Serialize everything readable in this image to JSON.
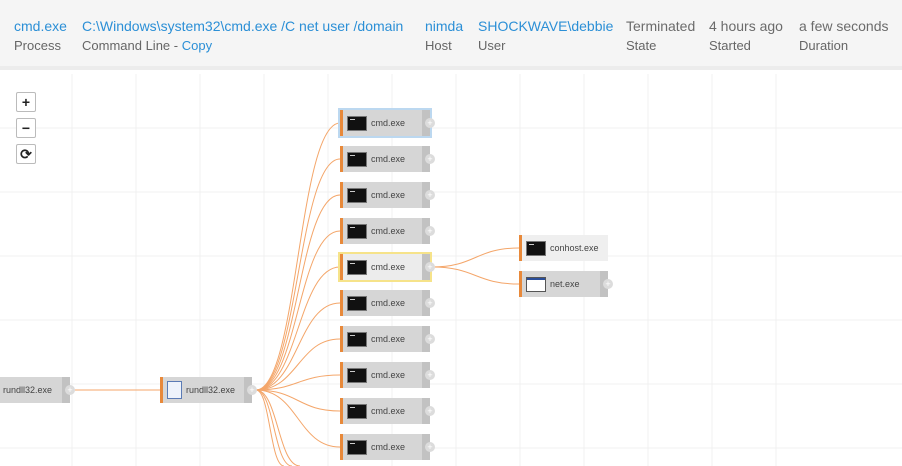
{
  "header": {
    "process": {
      "value": "cmd.exe",
      "label": "Process"
    },
    "command": {
      "value": "C:\\Windows\\system32\\cmd.exe /C net user /domain",
      "label": "Command Line - ",
      "copy": "Copy"
    },
    "host": {
      "value": "nimda",
      "label": "Host"
    },
    "user": {
      "value": "SHOCKWAVE\\debbie",
      "label": "User"
    },
    "state": {
      "value": "Terminated",
      "label": "State"
    },
    "started": {
      "value": "4 hours ago",
      "label": "Started"
    },
    "duration": {
      "value": "a few seconds",
      "label": "Duration"
    }
  },
  "controls": {
    "zoom_in": "+",
    "zoom_out": "−",
    "reset": "⟳"
  },
  "nodes": {
    "root": "rundll32.exe",
    "parent": "rundll32.exe",
    "cmd": [
      "cmd.exe",
      "cmd.exe",
      "cmd.exe",
      "cmd.exe",
      "cmd.exe",
      "cmd.exe",
      "cmd.exe",
      "cmd.exe",
      "cmd.exe",
      "cmd.exe"
    ],
    "conhost": "conhost.exe",
    "net": "net.exe",
    "expand": "+"
  }
}
